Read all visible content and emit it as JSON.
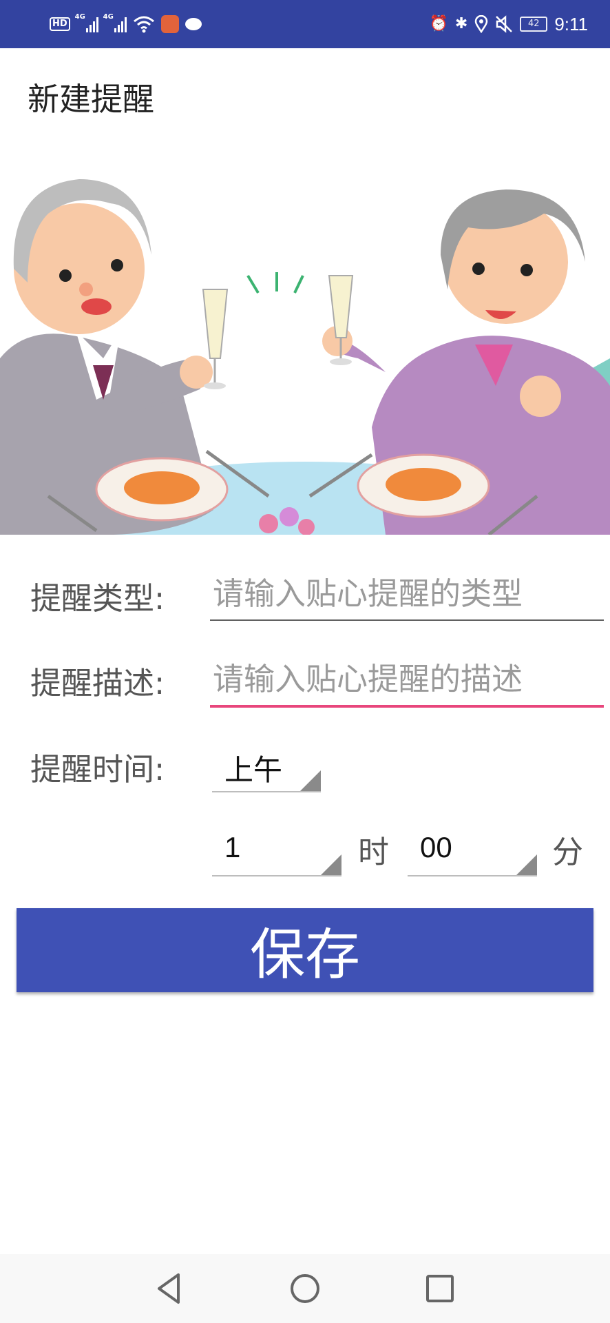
{
  "status_bar": {
    "left_icons": [
      "hd-icon",
      "signal-4g-icon",
      "signal-4g-icon",
      "wifi-icon",
      "app-notification-icon",
      "chat-icon"
    ],
    "hd_label": "HD",
    "net1": "4G",
    "net2": "4G",
    "battery": "42",
    "time": "9:11",
    "right_icons": [
      "alarm-icon",
      "bluetooth-icon",
      "location-icon",
      "mute-icon",
      "battery-icon"
    ]
  },
  "page": {
    "title": "新建提醒"
  },
  "form": {
    "type_label": "提醒类型:",
    "type_placeholder": "请输入贴心提醒的类型",
    "type_value": "",
    "desc_label": "提醒描述:",
    "desc_placeholder": "请输入贴心提醒的描述",
    "desc_value": "",
    "time_label": "提醒时间:",
    "ampm_value": "上午",
    "hour_value": "1",
    "hour_unit": "时",
    "minute_value": "00",
    "minute_unit": "分"
  },
  "actions": {
    "save_label": "保存"
  },
  "colors": {
    "status_bar": "#3343a0",
    "accent_button": "#3f51b5",
    "focused_underline": "#e8467c",
    "underline": "#616161",
    "label_text": "#555555",
    "hint_text": "#9a9a9a"
  },
  "nav": {
    "icons": [
      "back-icon",
      "home-icon",
      "recents-icon"
    ]
  }
}
